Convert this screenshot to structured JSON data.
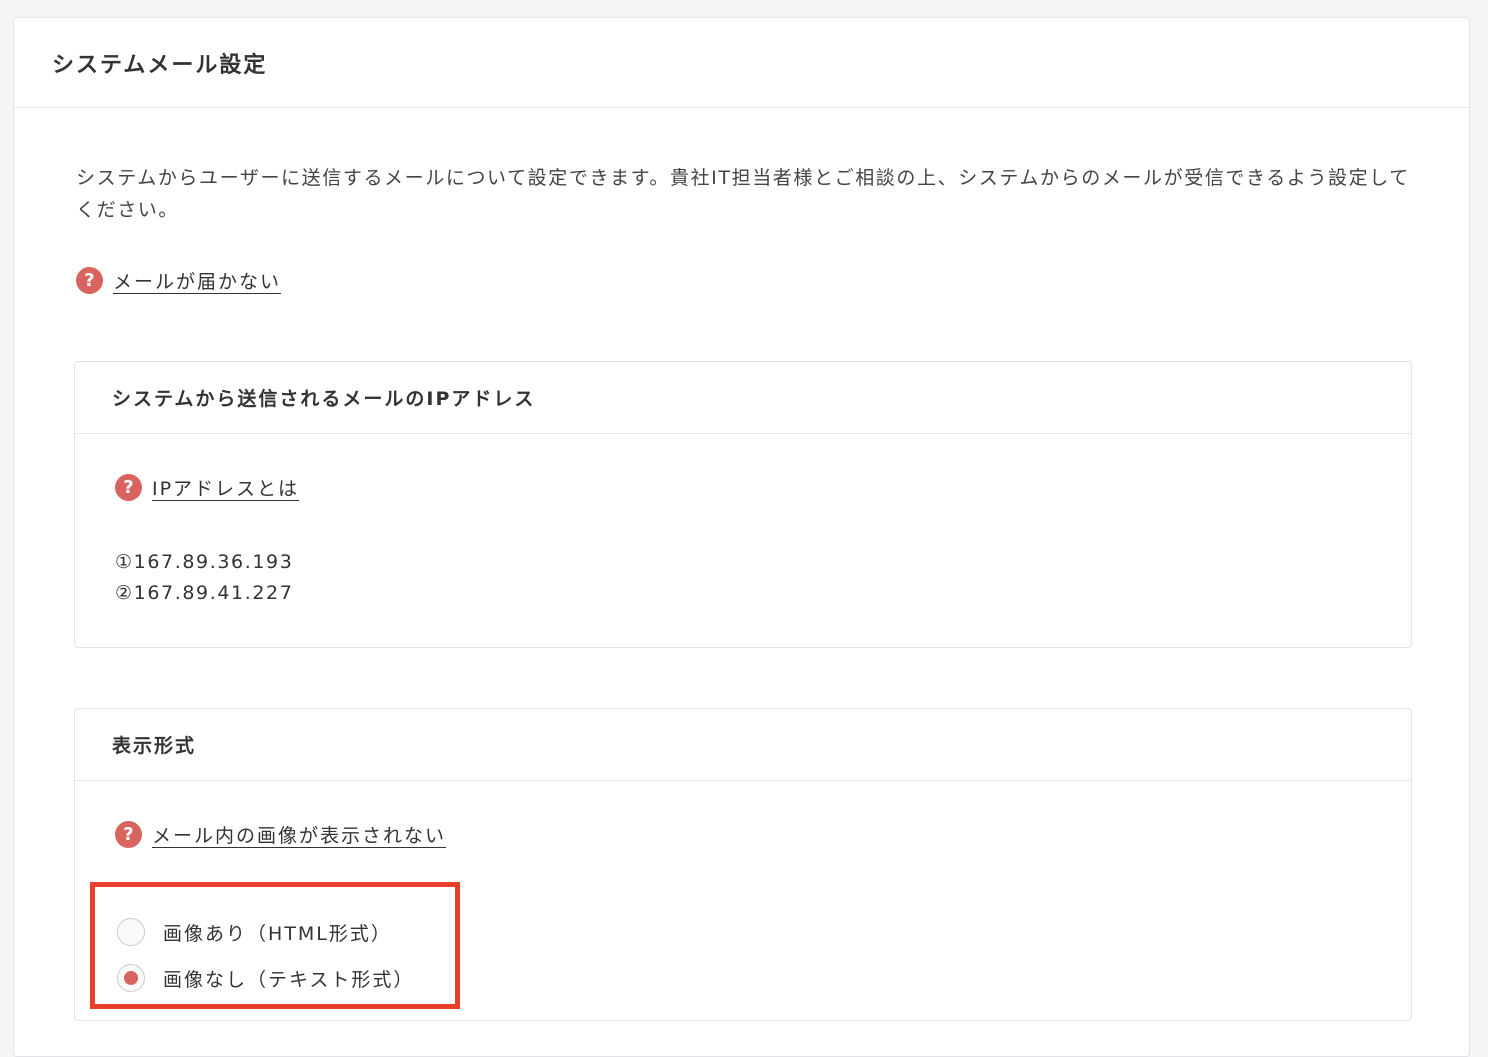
{
  "page": {
    "title": "システムメール設定",
    "description": "システムからユーザーに送信するメールについて設定できます。貴社IT担当者様とご相談の上、システムからのメールが受信できるよう設定してください。",
    "help_link": "メールが届かない"
  },
  "ip_section": {
    "title": "システムから送信されるメールのIPアドレス",
    "help_link": "IPアドレスとは",
    "addresses": [
      "①167.89.36.193",
      "②167.89.41.227"
    ]
  },
  "format_section": {
    "title": "表示形式",
    "help_link": "メール内の画像が表示されない",
    "options": [
      {
        "label": "画像あり（HTML形式）",
        "selected": false
      },
      {
        "label": "画像なし（テキスト形式）",
        "selected": true
      }
    ]
  },
  "icons": {
    "help": "question-circle-icon",
    "help_glyph": "?"
  },
  "colors": {
    "accent": "#d9645f",
    "highlight_border": "#e8402b"
  }
}
